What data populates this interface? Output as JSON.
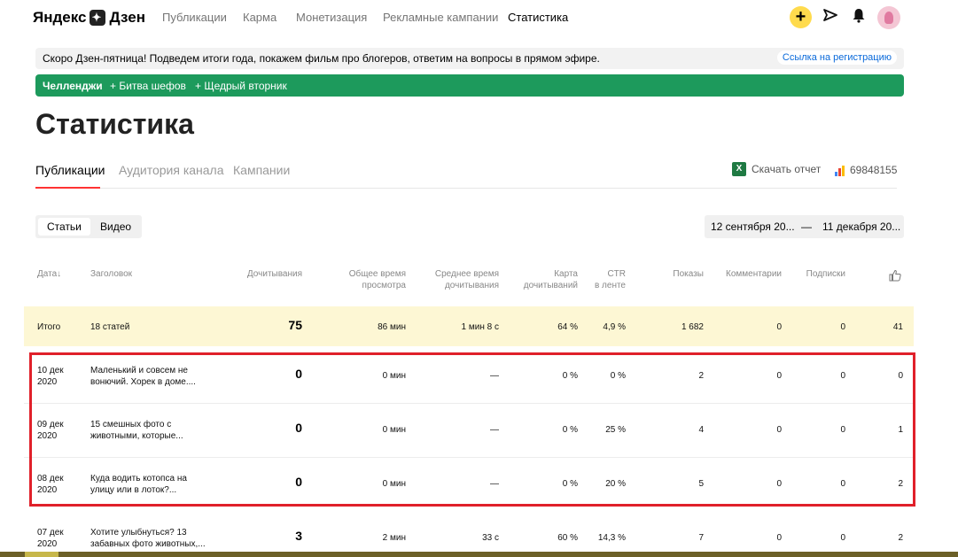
{
  "header": {
    "logo_text_left": "Яндекс",
    "logo_text_right": "Дзен",
    "nav": [
      "Публикации",
      "Карма",
      "Монетизация",
      "Рекламные кампании",
      "Статистика"
    ],
    "add_label": "+",
    "icons": [
      "send-icon",
      "bell-icon",
      "avatar"
    ]
  },
  "notice": {
    "text": "Скоро Дзен-пятница! Подведем итоги года, покажем фильм про блогеров, ответим на вопросы в прямом эфире.",
    "link": "Ссылка на регистрацию"
  },
  "challenges": {
    "label": "Челленджи",
    "items": [
      "+ Битва шефов",
      "+ Щедрый вторник"
    ]
  },
  "page_title": "Статистика",
  "tabs": [
    "Публикации",
    "Аудитория канала",
    "Кампании"
  ],
  "report_label": "Скачать отчет",
  "channel_id": "69848155",
  "segment": {
    "articles": "Статьи",
    "video": "Видео"
  },
  "date_range": {
    "from": "12 сентября 20...",
    "sep": "—",
    "to": "11 декабря 20..."
  },
  "table": {
    "headers": {
      "date": "Дата",
      "title": "Заголовок",
      "reads": "Дочитывания",
      "total_time_1": "Общее время",
      "total_time_2": "просмотра",
      "avg_time_1": "Среднее время",
      "avg_time_2": "дочитывания",
      "card_1": "Карта",
      "card_2": "дочитываний",
      "ctr_1": "CTR",
      "ctr_2": "в ленте",
      "views": "Показы",
      "comments": "Комментарии",
      "subs": "Подписки"
    },
    "total": {
      "label": "Итого",
      "title": "18 статей",
      "reads": "75",
      "total_time": "86 мин",
      "avg_time": "1 мин 8 с",
      "card": "64 %",
      "ctr": "4,9 %",
      "views": "1 682",
      "comments": "0",
      "subs": "0",
      "likes": "41"
    },
    "rows": [
      {
        "date1": "10 дек",
        "date2": "2020",
        "t1": "Маленький и совсем не",
        "t2": "вонючий. Хорек в доме....",
        "reads": "0",
        "total_time": "0 мин",
        "avg_time": "—",
        "card": "0 %",
        "ctr": "0 %",
        "views": "2",
        "comments": "0",
        "subs": "0",
        "likes": "0"
      },
      {
        "date1": "09 дек",
        "date2": "2020",
        "t1": "15 смешных фото с",
        "t2": "животными, которые...",
        "reads": "0",
        "total_time": "0 мин",
        "avg_time": "—",
        "card": "0 %",
        "ctr": "25 %",
        "views": "4",
        "comments": "0",
        "subs": "0",
        "likes": "1"
      },
      {
        "date1": "08 дек",
        "date2": "2020",
        "t1": "Куда водить котопса на",
        "t2": "улицу или в лоток?...",
        "reads": "0",
        "total_time": "0 мин",
        "avg_time": "—",
        "card": "0 %",
        "ctr": "20 %",
        "views": "5",
        "comments": "0",
        "subs": "0",
        "likes": "2"
      },
      {
        "date1": "07 дек",
        "date2": "2020",
        "t1": "Хотите улыбнуться? 13",
        "t2": "забавных фото животных,...",
        "reads": "3",
        "total_time": "2 мин",
        "avg_time": "33 с",
        "card": "60 %",
        "ctr": "14,3 %",
        "views": "7",
        "comments": "0",
        "subs": "0",
        "likes": "2"
      }
    ]
  }
}
